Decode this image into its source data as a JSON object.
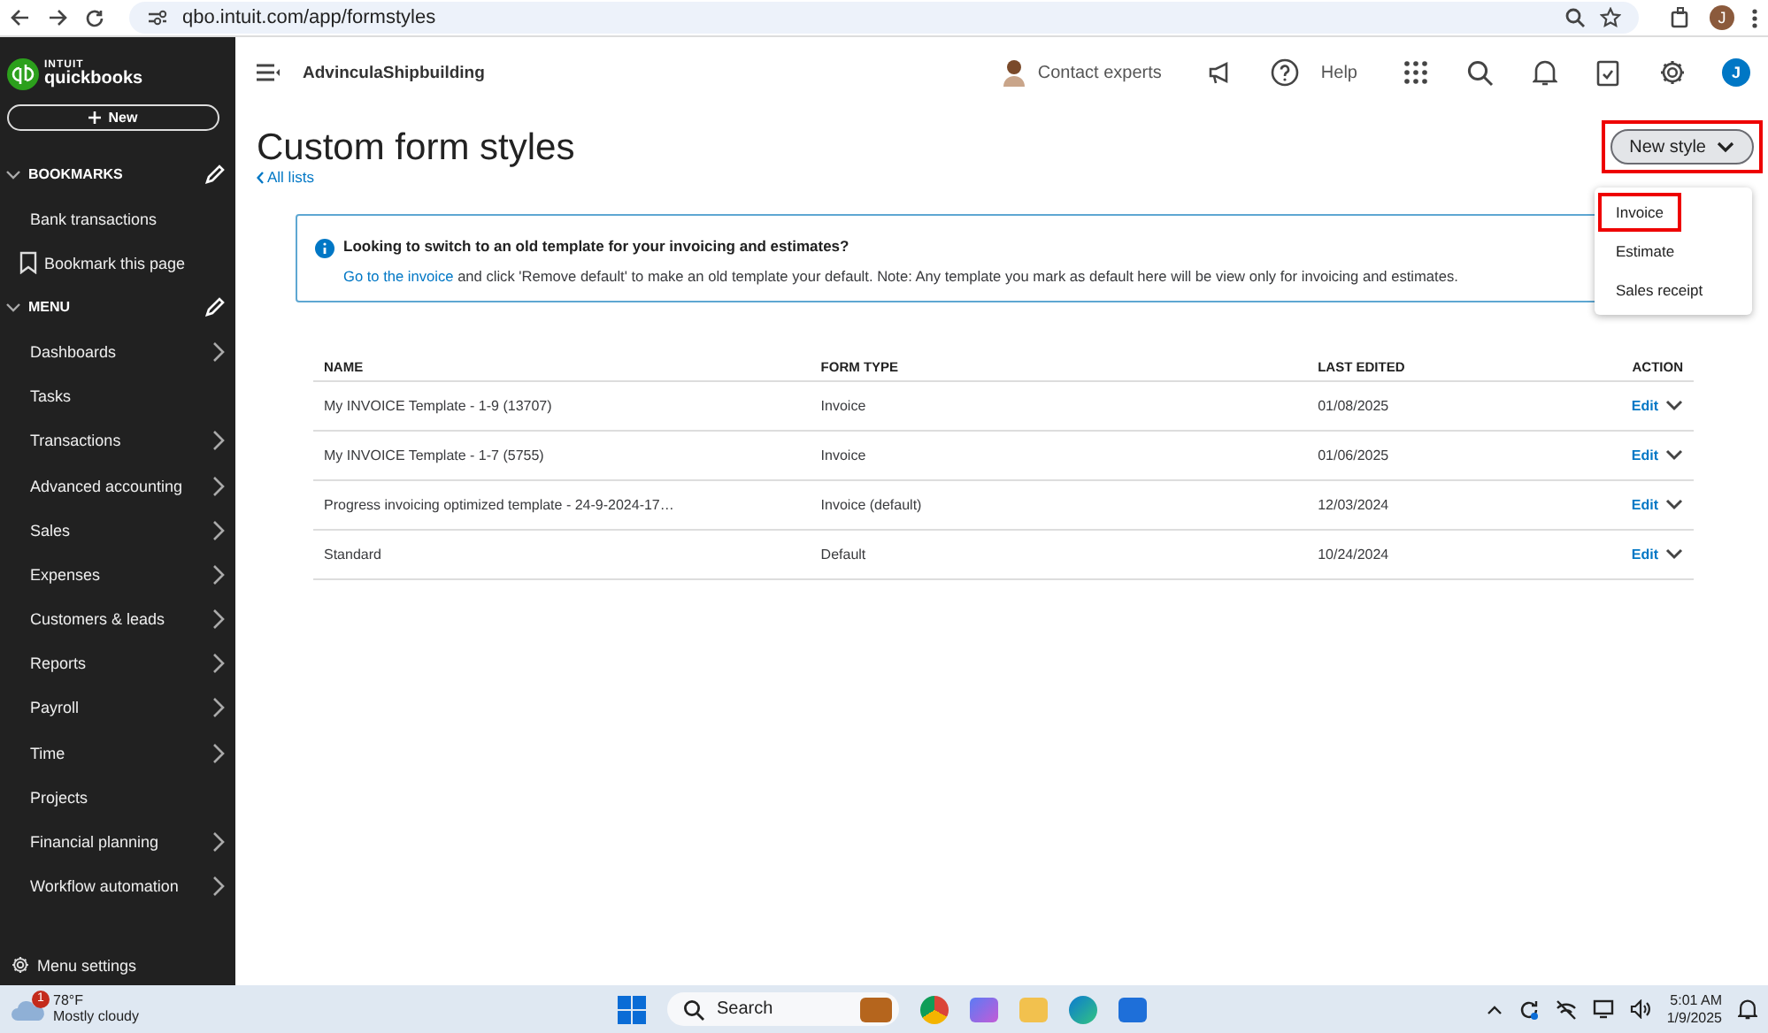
{
  "browser": {
    "url": "qbo.intuit.com/app/formstyles",
    "profile_initial": "J"
  },
  "sidebar": {
    "logo_top": "INTUIT",
    "logo_name": "quickbooks",
    "new_button": "New",
    "bookmarks": {
      "label": "BOOKMARKS",
      "expanded": true,
      "items": [
        {
          "label": "Bank transactions",
          "kind": "link"
        },
        {
          "label": "Bookmark this page",
          "kind": "bookmark"
        }
      ]
    },
    "menu": {
      "label": "MENU",
      "expanded": true,
      "items": [
        {
          "label": "Dashboards",
          "has_submenu": true
        },
        {
          "label": "Tasks",
          "has_submenu": false
        },
        {
          "label": "Transactions",
          "has_submenu": true
        },
        {
          "label": "Advanced accounting",
          "has_submenu": true
        },
        {
          "label": "Sales",
          "has_submenu": true
        },
        {
          "label": "Expenses",
          "has_submenu": true
        },
        {
          "label": "Customers & leads",
          "has_submenu": true
        },
        {
          "label": "Reports",
          "has_submenu": true
        },
        {
          "label": "Payroll",
          "has_submenu": true
        },
        {
          "label": "Time",
          "has_submenu": true
        },
        {
          "label": "Projects",
          "has_submenu": false
        },
        {
          "label": "Financial planning",
          "has_submenu": true
        },
        {
          "label": "Workflow automation",
          "has_submenu": true
        }
      ]
    },
    "settings": "Menu settings"
  },
  "topbar": {
    "company": "AdvinculaShipbuilding",
    "contact": "Contact experts",
    "help": "Help",
    "avatar_initial": "J"
  },
  "page": {
    "title": "Custom form styles",
    "back_link": "All lists",
    "new_style": {
      "label": "New style",
      "highlighted": true,
      "expanded": true,
      "options": [
        {
          "label": "Invoice",
          "highlighted": true
        },
        {
          "label": "Estimate",
          "highlighted": false
        },
        {
          "label": "Sales receipt",
          "highlighted": false
        }
      ]
    },
    "alert": {
      "title": "Looking to switch to an old template for your invoicing and estimates?",
      "link": "Go to the invoice",
      "text": "and click 'Remove default' to make an old template your default. Note: Any template you mark as default here will be view only for invoicing and estimates."
    },
    "table": {
      "columns": [
        "NAME",
        "FORM TYPE",
        "LAST EDITED",
        "ACTION"
      ],
      "rows": [
        {
          "name": "My INVOICE Template - 1-9 (13707)",
          "form_type": "Invoice",
          "last_edited": "01/08/2025",
          "action": "Edit"
        },
        {
          "name": "My INVOICE Template - 1-7 (5755)",
          "form_type": "Invoice",
          "last_edited": "01/06/2025",
          "action": "Edit"
        },
        {
          "name": "Progress invoicing optimized template - 24-9-2024-17…",
          "form_type": "Invoice (default)",
          "last_edited": "12/03/2024",
          "action": "Edit"
        },
        {
          "name": "Standard",
          "form_type": "Default",
          "last_edited": "10/24/2024",
          "action": "Edit"
        }
      ]
    }
  },
  "taskbar": {
    "weather_badge": "1",
    "temperature": "78°F",
    "weather": "Mostly cloudy",
    "search": "Search",
    "time": "5:01 AM",
    "date": "1/9/2025"
  }
}
